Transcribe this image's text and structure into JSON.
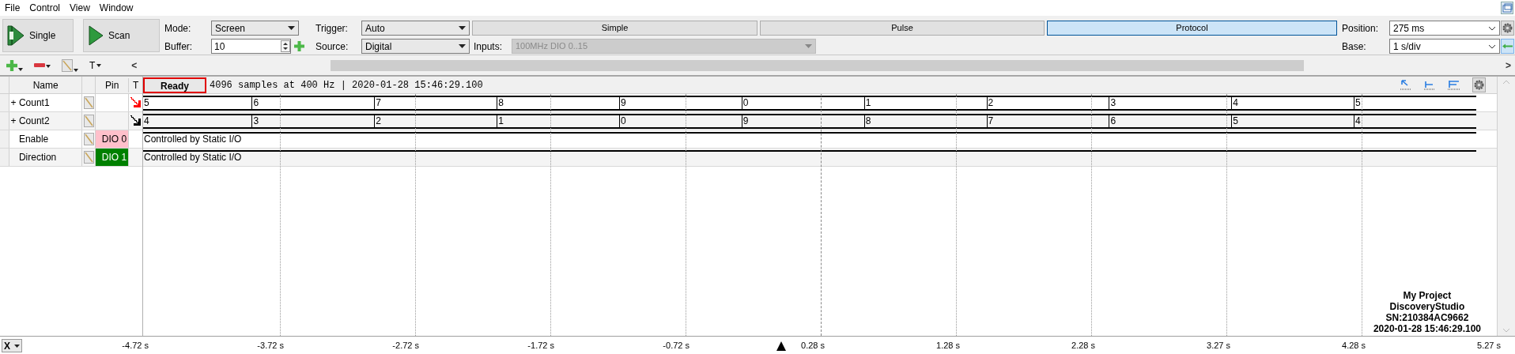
{
  "menu": [
    "File",
    "Control",
    "View",
    "Window"
  ],
  "toolbar": {
    "buttons": [
      {
        "kind": "single",
        "label": "Single"
      },
      {
        "kind": "scan",
        "label": "Scan"
      }
    ],
    "mode": {
      "label": "Mode:",
      "value": "Screen"
    },
    "buffer": {
      "label": "Buffer:",
      "value": "10"
    },
    "trigger": {
      "label": "Trigger:",
      "value": "Auto"
    },
    "source": {
      "label": "Source:",
      "value": "Digital"
    },
    "inputs": {
      "label": "Inputs:",
      "value": "100MHz DIO 0..15",
      "disabled": true
    },
    "tabs": [
      {
        "label": "Simple",
        "selected": false
      },
      {
        "label": "Pulse",
        "selected": false
      },
      {
        "label": "Protocol",
        "selected": true
      }
    ],
    "position": {
      "label": "Position:",
      "value": "275 ms"
    },
    "base": {
      "label": "Base:",
      "value": "1 s/div"
    }
  },
  "second_toolbar": {
    "text_menu": "T",
    "scroll_left": "<",
    "scroll_right": ">"
  },
  "columns": [
    "Name",
    "Pin",
    "T"
  ],
  "status": {
    "button": "Ready",
    "text": "4096 samples at 400 Hz | 2020-01-28 15:46:29.100"
  },
  "signals": [
    {
      "kind": "bus",
      "expander": "+",
      "name": "Count1",
      "trigger": {
        "color": "#ff0000"
      },
      "values": [
        "5",
        "6",
        "7",
        "8",
        "9",
        "0",
        "1",
        "2",
        "3",
        "4",
        "5"
      ]
    },
    {
      "kind": "bus",
      "expander": "+",
      "name": "Count2",
      "trigger": {
        "color": "#000000"
      },
      "values": [
        "4",
        "3",
        "2",
        "1",
        "0",
        "9",
        "8",
        "7",
        "6",
        "5",
        "4"
      ]
    },
    {
      "kind": "static",
      "name": "Enable",
      "pin": {
        "label": "DIO 0",
        "color": "#ffc0cb"
      },
      "text": "Controlled by Static I/O"
    },
    {
      "kind": "static",
      "name": "Direction",
      "pin": {
        "label": "DIO 1",
        "color": "#008000"
      },
      "text": "Controlled by Static I/O"
    }
  ],
  "info": [
    "My Project",
    "DiscoveryStudio",
    "SN:210384AC9662",
    "2020-01-28 15:46:29.100"
  ],
  "axis": {
    "selector": "X",
    "ticks": [
      "-4.72 s",
      "-3.72 s",
      "-2.72 s",
      "-1.72 s",
      "-0.72 s",
      "0.28 s",
      "1.28 s",
      "2.28 s",
      "3.27 s",
      "4.28 s",
      "5.27 s"
    ]
  }
}
